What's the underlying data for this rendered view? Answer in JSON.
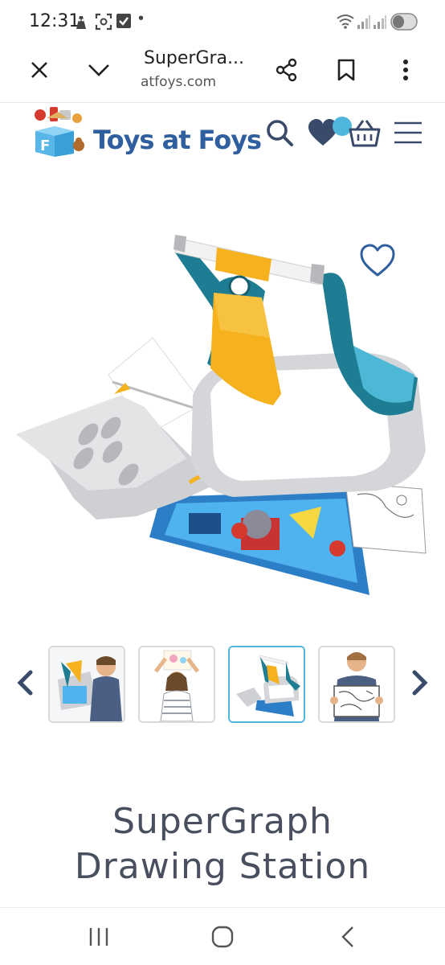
{
  "status_bar": {
    "time": "12:31",
    "notification_dot": "•",
    "icons": [
      "assistant-icon",
      "screenshot-icon",
      "checkbox-icon",
      "wifi-icon",
      "signal-icon",
      "signal-icon",
      "battery-icon"
    ]
  },
  "browser": {
    "page_title": "SuperGra...",
    "domain": "atfoys.com",
    "buttons": [
      "close-icon",
      "chevron-down-icon",
      "share-icon",
      "bookmark-icon",
      "more-options-icon"
    ]
  },
  "site_header": {
    "brand_name": "Toys at Foys",
    "logo_letter": "F",
    "icons": [
      "search-icon",
      "heart-icon",
      "basket-icon",
      "hamburger-menu-icon"
    ],
    "colors": {
      "brand": "#2f5f9e",
      "accent": "#4fb6de",
      "heart": "#3a4a6a"
    }
  },
  "gallery": {
    "thumbnails": [
      {
        "name": "boy-drawing-thumbnail",
        "active": false
      },
      {
        "name": "girl-holding-drawing-thumbnail",
        "active": false
      },
      {
        "name": "drawing-station-thumbnail",
        "active": true
      },
      {
        "name": "boy-showing-drawing-thumbnail",
        "active": false
      }
    ],
    "prev_icon": "chevron-left-icon",
    "next_icon": "chevron-right-icon"
  },
  "product": {
    "title_line1": "SuperGraph",
    "title_line2": "Drawing Station"
  },
  "nav_bar": {
    "buttons": [
      "recent-apps-icon",
      "home-icon",
      "back-icon"
    ]
  }
}
